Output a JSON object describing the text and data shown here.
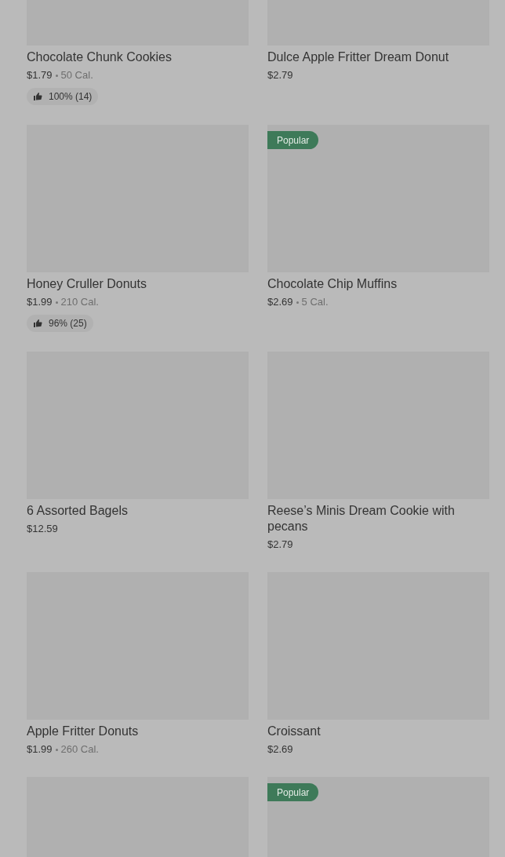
{
  "items": [
    {
      "name": "Chocolate Chunk Cookies",
      "price": "$1.79",
      "calories": "50 Cal.",
      "rating": "100% (14)"
    },
    {
      "name": "Dulce Apple Fritter Dream Donut",
      "price": "$2.79"
    },
    {
      "name": "Honey Cruller Donuts",
      "price": "$1.99",
      "calories": "210 Cal.",
      "rating": "96% (25)",
      "popular": false
    },
    {
      "name": "Chocolate Chip Muffins",
      "price": "$2.69",
      "calories": "5 Cal.",
      "popular": true,
      "badge": "Popular"
    },
    {
      "name": "6 Assorted Bagels",
      "price": "$12.59",
      "popular": false
    },
    {
      "name": "Reese’s Minis Dream Cookie with pecans",
      "price": "$2.79",
      "popular": false
    },
    {
      "name": "Apple Fritter Donuts",
      "price": "$1.99",
      "calories": "260 Cal.",
      "popular": false
    },
    {
      "name": "Croissant",
      "price": "$2.69",
      "popular": false
    },
    {
      "popular": false
    },
    {
      "popular": true,
      "badge": "Popular"
    }
  ]
}
